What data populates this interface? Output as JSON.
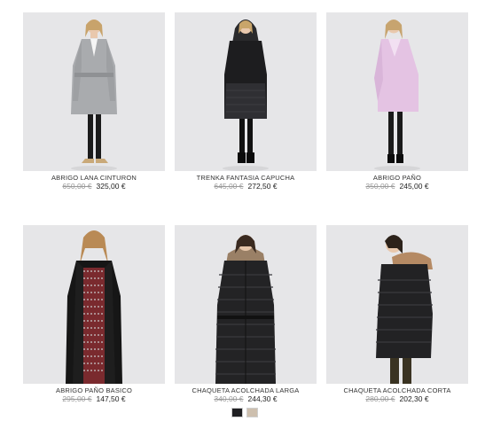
{
  "products": [
    {
      "name": "ABRIGO LANA CINTURON",
      "old_price": "650,00 €",
      "price": "325,00 €",
      "coat_color": "#a9abae",
      "image": "model-grey-belted-coat"
    },
    {
      "name": "TRENKA FANTASIA CAPUCHA",
      "old_price": "645,00 €",
      "price": "272,50 €",
      "coat_color": "#1d1d1f",
      "image": "model-black-hooded-trench"
    },
    {
      "name": "ABRIGO PAÑO",
      "old_price": "350,00 €",
      "price": "245,00 €",
      "coat_color": "#e4c3e3",
      "image": "model-lilac-coat"
    },
    {
      "name": "ABRIGO PAÑO BASICO",
      "old_price": "295,00 €",
      "price": "147,50 €",
      "coat_color": "#161616",
      "image": "model-black-basic-coat"
    },
    {
      "name": "CHAQUETA ACOLCHADA LARGA",
      "old_price": "340,00 €",
      "price": "244,30 €",
      "coat_color": "#232325",
      "image": "model-long-padded-jacket"
    },
    {
      "name": "CHAQUETA ACOLCHADA CORTA",
      "old_price": "280,00 €",
      "price": "202,30 €",
      "coat_color": "#222224",
      "image": "model-short-padded-jacket"
    }
  ],
  "swatches": [
    {
      "color": "#1f1f22",
      "name": "black"
    },
    {
      "color": "#cdbfae",
      "name": "beige"
    }
  ]
}
